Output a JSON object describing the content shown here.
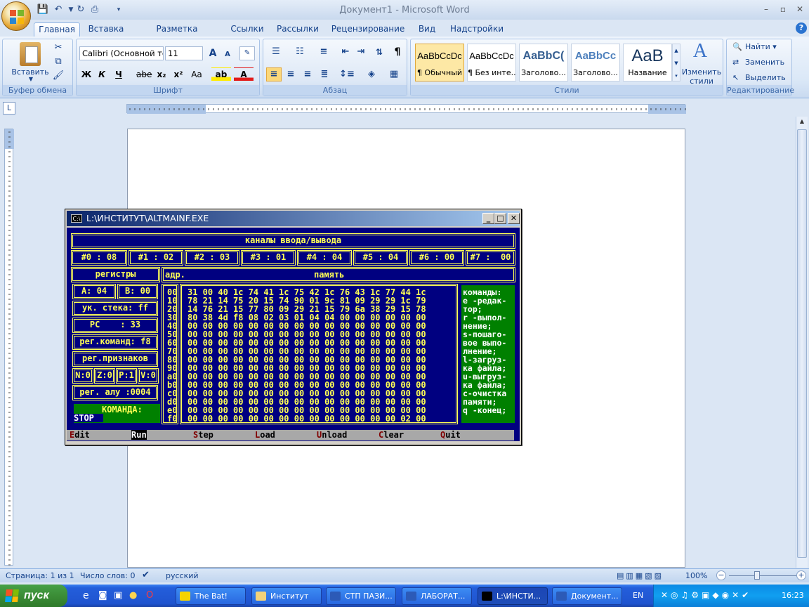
{
  "window": {
    "title": "Документ1 - Microsoft Word",
    "minimize": "–",
    "maximize": "▫",
    "close": "✕",
    "help": "?"
  },
  "ribbon": {
    "tabs": [
      "Главная",
      "Вставка",
      "Разметка страницы",
      "Ссылки",
      "Рассылки",
      "Рецензирование",
      "Вид",
      "Надстройки"
    ],
    "active_tab": "Главная",
    "clipboard": {
      "label": "Буфер обмена",
      "paste": "Вставить"
    },
    "font": {
      "label": "Шрифт",
      "name": "Calibri (Основной те",
      "size": "11",
      "bold": "Ж",
      "italic": "К",
      "underline": "Ч",
      "strike": "abe",
      "sub": "x₂",
      "sup": "x²",
      "case": "Aa",
      "grow": "A",
      "shrink": "A",
      "font_color": "A"
    },
    "paragraph": {
      "label": "Абзац",
      "pilcrow": "¶"
    },
    "styles": {
      "label": "Стили",
      "items": [
        {
          "sample": "AaBbCcDc",
          "name": "¶ Обычный"
        },
        {
          "sample": "AaBbCcDc",
          "name": "¶ Без инте..."
        },
        {
          "sample": "AaBbC(",
          "name": "Заголово..."
        },
        {
          "sample": "AaBbCc",
          "name": "Заголово..."
        },
        {
          "sample": "AaB",
          "name": "Название"
        }
      ],
      "change": "Изменить стили"
    },
    "editing": {
      "label": "Редактирование",
      "find": "Найти",
      "replace": "Заменить",
      "select": "Выделить"
    }
  },
  "console": {
    "title": "L:\\ИНСТИТУТ\\ALTMAINF.EXE",
    "icon_label": "C:\\",
    "header": "каналы ввода/вывода",
    "channels": [
      "#0 : 08",
      "#1 : 02",
      "#2 : 03",
      "#3 : 01",
      "#4 : 04",
      "#5 : 04",
      "#6 : 00",
      "#7 :  00"
    ],
    "registers_title": "регистры",
    "addr_title": "адр.",
    "memory_title": "память",
    "reg_a": "A: 04",
    "reg_b": "B: 00",
    "stack_ptr": "ук. стека: ff",
    "pc": "PC    : 33",
    "cmd_reg": "рег.команд: f8",
    "flags_title": "рег.признаков",
    "flag_n": "N:0",
    "flag_z": "Z:0",
    "flag_p": "P:1",
    "flag_v": "V:0",
    "alu_reg": "рег. алу :0004",
    "command_label": "КОМАНДА:",
    "command_value": "STOP",
    "addresses": [
      "00",
      "10",
      "20",
      "30",
      "40",
      "50",
      "60",
      "70",
      "80",
      "90",
      "a0",
      "b0",
      "c0",
      "d0",
      "e0",
      "f0"
    ],
    "memory": [
      "31 00 40 1c 74 41 1c 75 42 1c 76 43 1c 77 44 1c",
      "78 21 14 75 20 15 74 90 01 9c 81 09 29 29 1c 79",
      "14 76 21 15 77 80 09 29 21 15 79 6a 38 29 15 78",
      "80 38 4d f8 08 02 03 01 04 04 00 00 00 00 00 00",
      "00 00 00 00 00 00 00 00 00 00 00 00 00 00 00 00",
      "00 00 00 00 00 00 00 00 00 00 00 00 00 00 00 00",
      "00 00 00 00 00 00 00 00 00 00 00 00 00 00 00 00",
      "00 00 00 00 00 00 00 00 00 00 00 00 00 00 00 00",
      "00 00 00 00 00 00 00 00 00 00 00 00 00 00 00 00",
      "00 00 00 00 00 00 00 00 00 00 00 00 00 00 00 00",
      "00 00 00 00 00 00 00 00 00 00 00 00 00 00 00 00",
      "00 00 00 00 00 00 00 00 00 00 00 00 00 00 00 00",
      "00 00 00 00 00 00 00 00 00 00 00 00 00 00 00 00",
      "00 00 00 00 00 00 00 00 00 00 00 00 00 00 00 00",
      "00 00 00 00 00 00 00 00 00 00 00 00 00 00 00 00",
      "00 00 00 00 00 00 00 00 00 00 00 00 00 00 02 00"
    ],
    "commands_help": "команды:\ne -редак-\nтор;\nr -выпол-\nнение;\ns-пошаго-\nвое выпо-\nлнение;\nl-загруз-\nка файла;\nu-выгруз-\nка файла;\nc-очистка\nпамяти;\nq -конец;",
    "menu": [
      {
        "hot": "E",
        "rest": "dit"
      },
      {
        "hot": "R",
        "rest": "un"
      },
      {
        "hot": "S",
        "rest": "tep"
      },
      {
        "hot": "L",
        "rest": "oad"
      },
      {
        "hot": "U",
        "rest": "nload"
      },
      {
        "hot": "C",
        "rest": "lear"
      },
      {
        "hot": "Q",
        "rest": "uit"
      }
    ]
  },
  "status": {
    "page": "Страница: 1 из 1",
    "words": "Число слов: 0",
    "language": "русский",
    "zoom": "100%"
  },
  "taskbar": {
    "start": "пуск",
    "tasks": [
      {
        "label": "The Bat!",
        "color": "#f5d400"
      },
      {
        "label": "Институт",
        "color": "#f3d27a"
      },
      {
        "label": "СТП ПАЗИ...",
        "color": "#2c5ab7"
      },
      {
        "label": "ЛАБОРАТ...",
        "color": "#2c5ab7"
      },
      {
        "label": "L:\\ИНСТИ...",
        "color": "#000000"
      },
      {
        "label": "Документ...",
        "color": "#2c5ab7"
      }
    ],
    "lang": "EN",
    "clock": "16:23"
  },
  "colors": {
    "dos_bg": "#000080",
    "dos_fg": "#ffff55",
    "dos_green": "#008000"
  }
}
